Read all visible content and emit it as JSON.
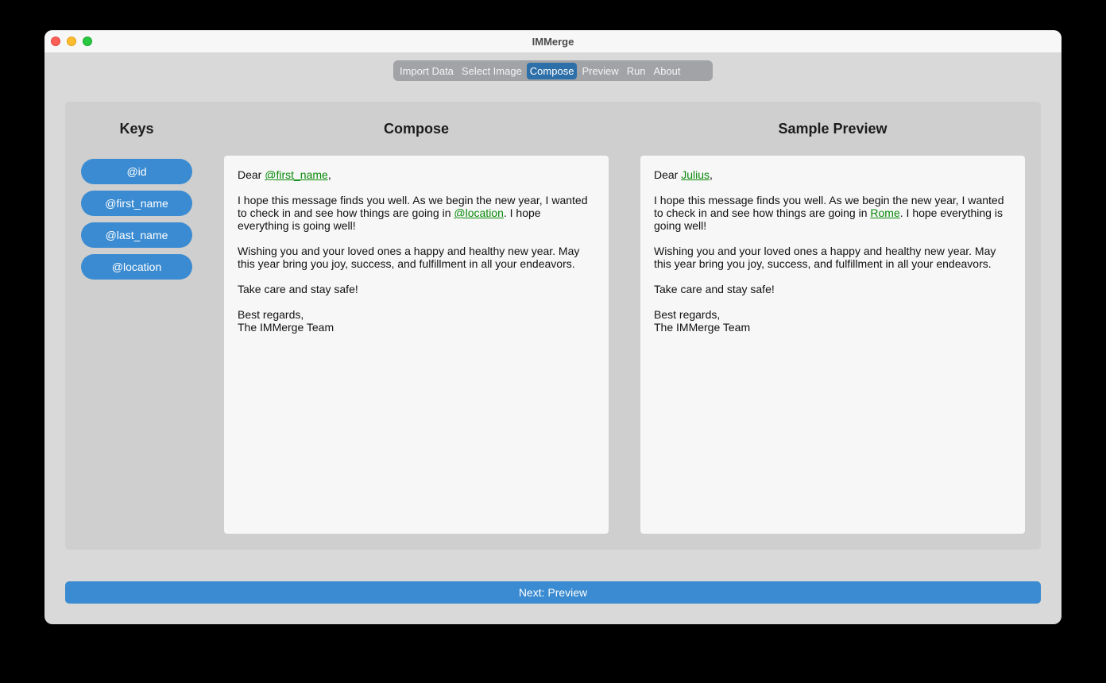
{
  "window": {
    "title": "IMMerge"
  },
  "tabs": [
    {
      "label": "Import Data",
      "active": false
    },
    {
      "label": "Select Image",
      "active": false
    },
    {
      "label": "Compose",
      "active": true
    },
    {
      "label": "Preview",
      "active": false
    },
    {
      "label": "Run",
      "active": false
    },
    {
      "label": "About",
      "active": false
    }
  ],
  "keys": {
    "title": "Keys",
    "items": [
      "@id",
      "@first_name",
      "@last_name",
      "@location"
    ]
  },
  "compose": {
    "title": "Compose",
    "greeting_prefix": "Dear ",
    "greeting_token": "@first_name",
    "greeting_suffix": ",",
    "para1_before": "I hope this message finds you well. As we begin the new year, I wanted to check in and see how things are going in ",
    "para1_token": "@location",
    "para1_after": ". I hope everything is going well!",
    "para2": "Wishing you and your loved ones a happy and healthy new year. May this year bring you joy, success, and fulfillment in all your endeavors.",
    "para3": "Take care and stay safe!",
    "signoff_line1": "Best regards,",
    "signoff_line2": "The IMMerge Team"
  },
  "preview": {
    "title": "Sample Preview",
    "greeting_prefix": "Dear ",
    "greeting_token": "Julius",
    "greeting_suffix": ",",
    "para1_before": "I hope this message finds you well. As we begin the new year, I wanted to check in and see how things are going in ",
    "para1_token": "Rome",
    "para1_after": ". I hope everything is going well!",
    "para2": "Wishing you and your loved ones a happy and healthy new year. May this year bring you joy, success, and fulfillment in all your endeavors.",
    "para3": "Take care and stay safe!",
    "signoff_line1": "Best regards,",
    "signoff_line2": "The IMMerge Team"
  },
  "footer": {
    "next_label": "Next: Preview"
  },
  "colors": {
    "accent": "#3a8bd1",
    "active_tab": "#2d6fa8",
    "token": "#0a8a0a"
  }
}
